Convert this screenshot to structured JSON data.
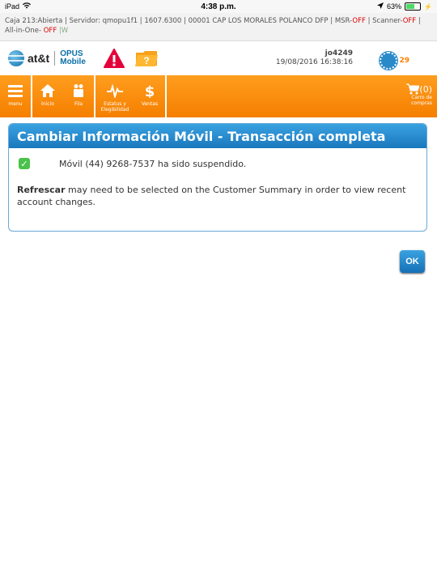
{
  "status_bar": {
    "device": "iPad",
    "time": "4:38 p.m.",
    "battery": "63%",
    "battery_level": 0.63
  },
  "info_bar": {
    "text_1": "Caja 213:Abierta  |  Servidor: qmopu1f1  |  1607.6300  |  00001 CAP LOS MORALES POLANCO DFP  |  MSR-",
    "msr": "OFF",
    "text_2": "  |  Scanner-",
    "scanner": "OFF",
    "text_3": "  |  All-in-One- ",
    "allinone": "OFF",
    "text_4": " |",
    "w": "W"
  },
  "header": {
    "brand": "at&t",
    "app_name_1": "OPUS",
    "app_name_2": "Mobile",
    "user_id": "jo4249",
    "datetime": "19/08/2016 16:38:16",
    "badge_count": "29"
  },
  "nav": {
    "items": [
      {
        "label": "menu",
        "icon": "menu-icon"
      },
      {
        "label": "Inicio",
        "icon": "home-icon"
      },
      {
        "label": "Fila",
        "icon": "queue-icon"
      },
      {
        "label": "Estatus y Elegibilidad",
        "icon": "pulse-icon"
      },
      {
        "label": "Ventas",
        "icon": "dollar-icon"
      }
    ],
    "cart_count": "(0)",
    "cart_label": "Carro de compras"
  },
  "panel": {
    "title": "Cambiar Información Móvil - Transacción completa",
    "message": "Móvil (44) 9268-7537 ha sido suspendido.",
    "note_bold": "Refrescar",
    "note_rest": " may need to be selected on the Customer Summary in order to view recent account changes."
  },
  "ok_button": "OK",
  "colors": {
    "accent_orange": "#f57f00",
    "accent_blue": "#1a78bd",
    "success_green": "#4cc24c",
    "off_red": "#dd0000"
  }
}
